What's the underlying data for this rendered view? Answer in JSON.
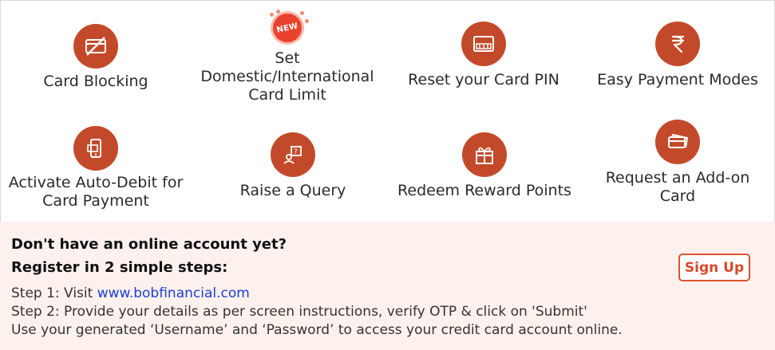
{
  "tiles": [
    {
      "id": "card-blocking",
      "label": "Card Blocking",
      "icon": "card-blocked-icon"
    },
    {
      "id": "set-limit",
      "label": [
        "Set",
        "Domestic/International",
        "Card Limit"
      ],
      "badge": "NEW",
      "icon": "new-badge-icon"
    },
    {
      "id": "reset-pin",
      "label": "Reset your Card PIN",
      "icon": "pin-card-icon"
    },
    {
      "id": "easy-payment",
      "label": "Easy Payment Modes",
      "icon": "rupee-icon"
    },
    {
      "id": "auto-debit",
      "label": [
        "Activate Auto-Debit for",
        "Card Payment"
      ],
      "icon": "auto-debit-icon"
    },
    {
      "id": "raise-query",
      "label": "Raise a Query",
      "icon": "query-icon"
    },
    {
      "id": "redeem-rewards",
      "label": "Redeem Reward Points",
      "icon": "gift-icon"
    },
    {
      "id": "add-on-card",
      "label": [
        "Request an Add-on",
        "Card"
      ],
      "icon": "add-on-card-icon"
    }
  ],
  "register": {
    "question": "Don't have an online account yet?",
    "subtitle": "Register in 2 simple steps:",
    "step1_prefix": "Step 1: Visit ",
    "step1_link": "www.bobfinancial.com",
    "step2": "Step 2: Provide your details as per screen instructions, verify OTP & click on 'Submit'",
    "note": "Use your generated ‘Username’ and ‘Password’ to access your credit card account online.",
    "signup_label": "Sign Up"
  },
  "colors": {
    "icon_bg": "#c24a2b",
    "accent": "#e0522f",
    "panel_bg": "#fdf1ee",
    "link": "#1a3fd6"
  }
}
